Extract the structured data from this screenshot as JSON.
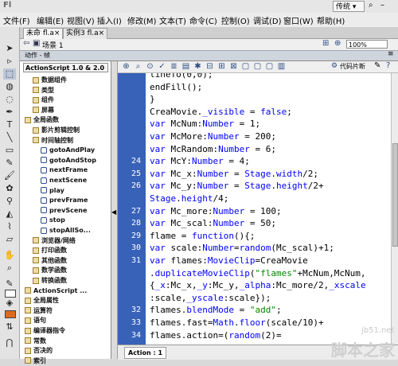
{
  "titlebar": {
    "app_letters": "Fl",
    "workspace": "传统",
    "search_glyph": "⌕"
  },
  "menu": [
    "文件(F)",
    "编辑(E)",
    "视图(V)",
    "插入(I)",
    "修改(M)",
    "文本(T)",
    "命令(C)",
    "控制(O)",
    "调试(D)",
    "窗口(W)",
    "帮助(H)"
  ],
  "doc_tabs": [
    {
      "label": "未命 fl.a×"
    },
    {
      "label": "实例3 fl.a×"
    }
  ],
  "scene": {
    "label": "场景 1",
    "zoom": "100%"
  },
  "actions_panel": {
    "title": "动作 - 帧",
    "version": "ActionScript 1.0 & 2.0",
    "code_snippets": "代码片断"
  },
  "left_tree": [
    {
      "label": "数据组件",
      "indent": 1,
      "type": "folder"
    },
    {
      "label": "类型",
      "indent": 1,
      "type": "folder"
    },
    {
      "label": "组件",
      "indent": 1,
      "type": "folder"
    },
    {
      "label": "屏幕",
      "indent": 1,
      "type": "folder"
    },
    {
      "label": "全局函数",
      "indent": 0,
      "type": "folder"
    },
    {
      "label": "影片剪辑控制",
      "indent": 1,
      "type": "folder"
    },
    {
      "label": "时间轴控制",
      "indent": 1,
      "type": "folder"
    },
    {
      "label": "gotoAndPlay",
      "indent": 2,
      "type": "func"
    },
    {
      "label": "gotoAndStop",
      "indent": 2,
      "type": "func"
    },
    {
      "label": "nextFrame",
      "indent": 2,
      "type": "func"
    },
    {
      "label": "nextScene",
      "indent": 2,
      "type": "func"
    },
    {
      "label": "play",
      "indent": 2,
      "type": "func"
    },
    {
      "label": "prevFrame",
      "indent": 2,
      "type": "func"
    },
    {
      "label": "prevScene",
      "indent": 2,
      "type": "func"
    },
    {
      "label": "stop",
      "indent": 2,
      "type": "func"
    },
    {
      "label": "stopAllSo...",
      "indent": 2,
      "type": "func"
    },
    {
      "label": "浏览器/网络",
      "indent": 1,
      "type": "folder"
    },
    {
      "label": "打印函数",
      "indent": 1,
      "type": "folder"
    },
    {
      "label": "其他函数",
      "indent": 1,
      "type": "folder"
    },
    {
      "label": "数学函数",
      "indent": 1,
      "type": "folder"
    },
    {
      "label": "转换函数",
      "indent": 1,
      "type": "folder"
    },
    {
      "label": "ActionScript ...",
      "indent": 0,
      "type": "folder"
    },
    {
      "label": "全局属性",
      "indent": 0,
      "type": "folder"
    },
    {
      "label": "运算符",
      "indent": 0,
      "type": "folder"
    },
    {
      "label": "语句",
      "indent": 0,
      "type": "folder"
    },
    {
      "label": "编译器指令",
      "indent": 0,
      "type": "folder"
    },
    {
      "label": "常数",
      "indent": 0,
      "type": "folder"
    },
    {
      "label": "否决的",
      "indent": 0,
      "type": "folder"
    },
    {
      "label": "索引",
      "indent": 0,
      "type": "folder"
    }
  ],
  "code_lines": [
    {
      "num": "",
      "text": "lineTo(0,0);"
    },
    {
      "num": "",
      "text": "endFill();"
    },
    {
      "num": "",
      "text": "}"
    },
    {
      "num": "",
      "text": "CreaMovie._visible = false;"
    },
    {
      "num": "",
      "text": "var McNum:Number = 1;"
    },
    {
      "num": "",
      "text": "var McMore:Number = 200;"
    },
    {
      "num": "",
      "text": "var McRandom:Number = 6;"
    },
    {
      "num": "24",
      "text": "var McY:Number = 4;"
    },
    {
      "num": "25",
      "text": "var Mc_x:Number = Stage.width/2;"
    },
    {
      "num": "26",
      "text": "var Mc_y:Number = Stage.height/2+"
    },
    {
      "num": "",
      "text": "Stage.height/4;"
    },
    {
      "num": "27",
      "text": "var Mc_more:Number = 100;"
    },
    {
      "num": "28",
      "text": "var Mc_scal:Number = 50;"
    },
    {
      "num": "29",
      "text": "flame = function(){;"
    },
    {
      "num": "30",
      "text": "var scale:Number=random(Mc_scal)+1;"
    },
    {
      "num": "31",
      "text": "var flames:MovieClip=CreaMovie"
    },
    {
      "num": "",
      "text": ".duplicateMovieClip(\"flames\"+McNum,McNum,"
    },
    {
      "num": "",
      "text": "{_x:Mc_x,_y:Mc_y,_alpha:Mc_more/2,_xscale"
    },
    {
      "num": "",
      "text": ":scale,_yscale:scale});"
    },
    {
      "num": "32",
      "text": "flames.blendMode = \"add\";"
    },
    {
      "num": "33",
      "text": "flames.fast=Math.floor(scale/10)+"
    },
    {
      "num": "34",
      "text": "flames.action=(random(2)="
    }
  ],
  "bottom_tab": "Action : 1",
  "watermark": {
    "site": "jb51.net",
    "brand": "脚本之家"
  }
}
